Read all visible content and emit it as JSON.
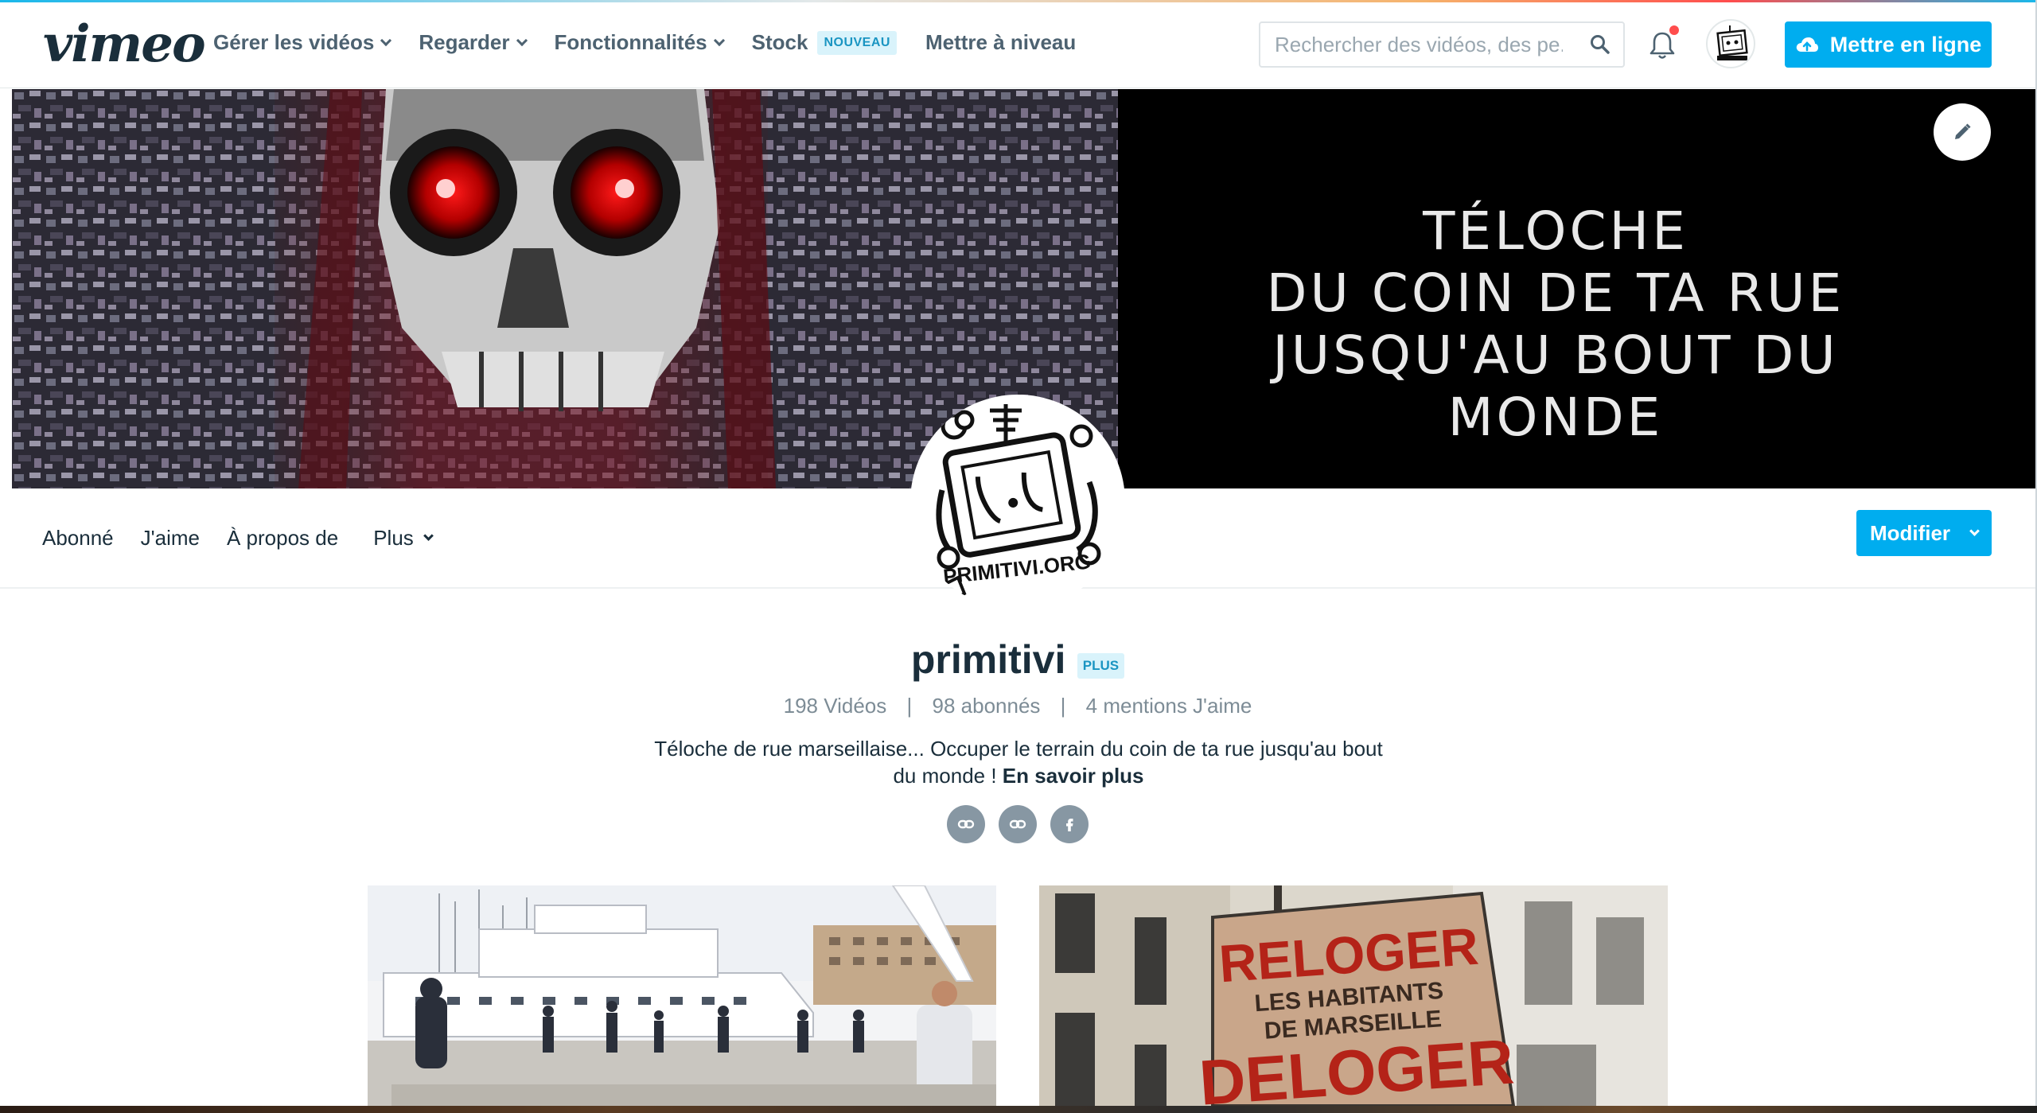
{
  "brand": {
    "logo_text": "vimeo"
  },
  "nav": {
    "items": [
      {
        "label": "Gérer les vidéos",
        "dropdown": true
      },
      {
        "label": "Regarder",
        "dropdown": true
      },
      {
        "label": "Fonctionnalités",
        "dropdown": true
      },
      {
        "label": "Stock",
        "badge": "NOUVEAU"
      },
      {
        "label": "Mettre à niveau"
      }
    ]
  },
  "search": {
    "placeholder": "Rechercher des vidéos, des pe..."
  },
  "header": {
    "upload_label": "Mettre en ligne"
  },
  "banner": {
    "lines": [
      "TÉLOCHE",
      "DU COIN DE TA RUE",
      "JUSQU'AU BOUT DU MONDE"
    ]
  },
  "profile_nav": {
    "tabs": [
      "Abonné",
      "J'aime",
      "À propos de"
    ],
    "more_label": "Plus",
    "edit_label": "Modifier"
  },
  "profile": {
    "avatar_text": "PRIMITIVI.ORG",
    "name": "primitivi",
    "plan_badge": "PLUS",
    "stats": [
      "198 Vidéos",
      "98 abonnés",
      "4 mentions J'aime"
    ],
    "bio_line1": "Téloche de rue marseillaise... Occuper le terrain du coin de ta rue jusqu'au bout",
    "bio_line2": "du monde ! ",
    "bio_more": "En savoir plus",
    "socials": [
      "link-icon",
      "link-icon",
      "facebook-icon"
    ]
  },
  "videos": [
    {
      "thumbnail": "harbor-scene"
    },
    {
      "thumbnail": "protest-sign",
      "sign_lines": [
        "RELOGER",
        "LES HABITANTS",
        "DE MARSEILLE",
        "DELOGER"
      ]
    }
  ],
  "colors": {
    "accent": "#00adef",
    "text": "#1a2e3b",
    "muted": "#7d8c96",
    "badge_bg": "#d9f3fb"
  }
}
